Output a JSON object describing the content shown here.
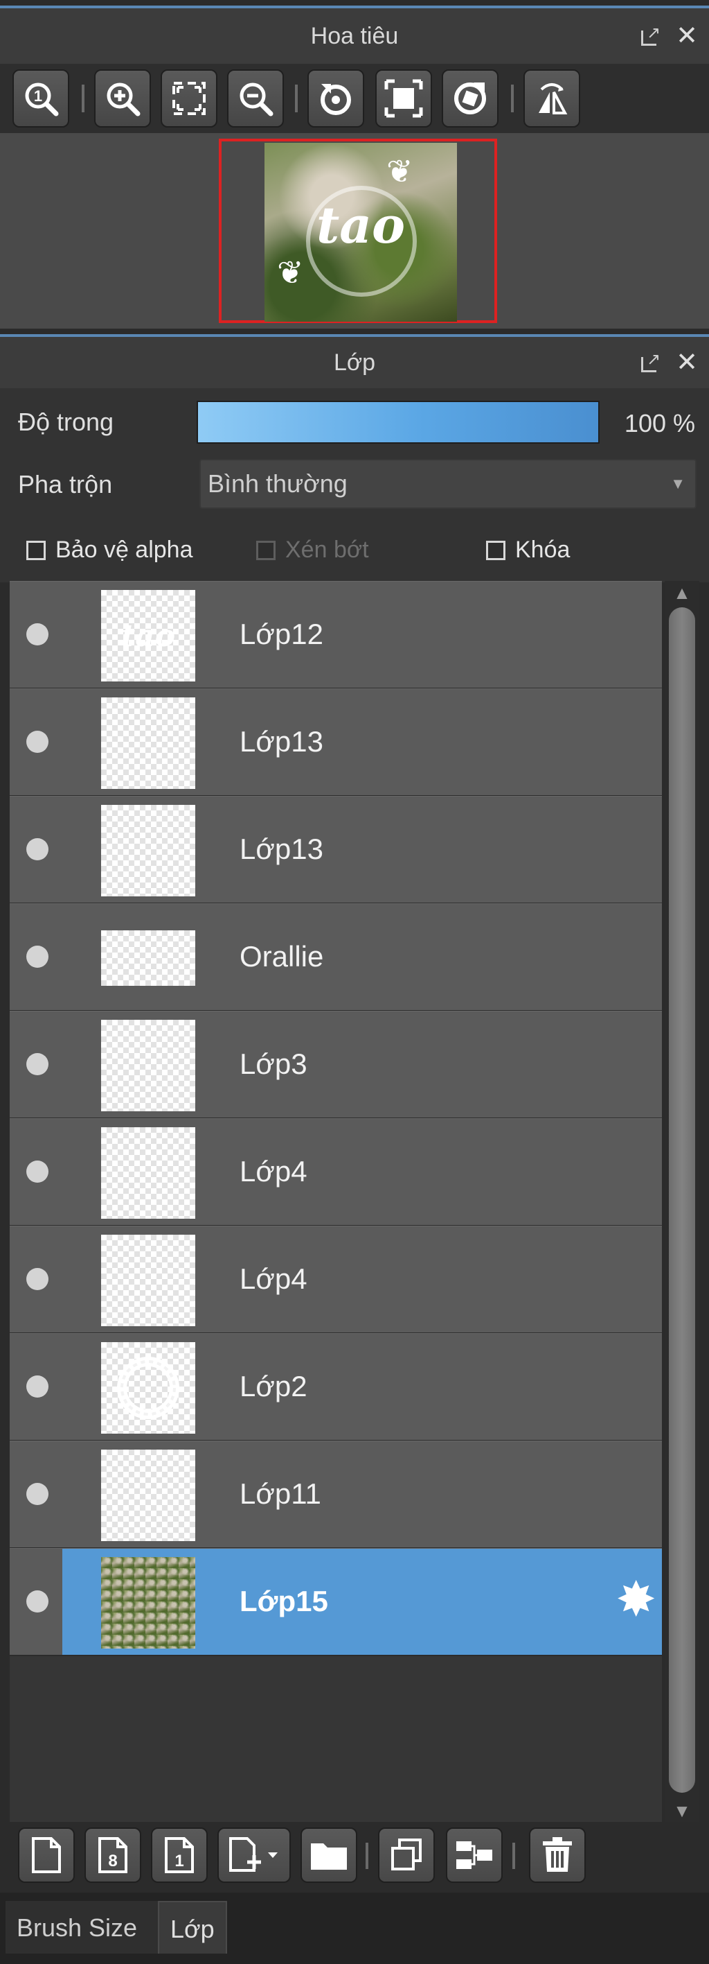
{
  "navigator": {
    "title": "Hoa tiêu",
    "preview_text": "tao",
    "toolbar_icons": [
      "zoom-actual-icon",
      "zoom-in-icon",
      "fit-window-icon",
      "zoom-out-icon",
      "rotate-left-icon",
      "fit-canvas-icon",
      "rotate-right-icon",
      "flip-horizontal-icon"
    ]
  },
  "layer_panel": {
    "title": "Lớp",
    "opacity_label": "Độ trong",
    "opacity_value": "100 %",
    "opacity": 1.0,
    "blend_label": "Pha trộn",
    "blend_value": "Bình thường",
    "protect_alpha_label": "Bảo vệ alpha",
    "clipping_label": "Xén bớt",
    "lock_label": "Khóa",
    "layers": [
      {
        "name": "Lớp12",
        "thumb": "text"
      },
      {
        "name": "Lớp13",
        "thumb": "blank"
      },
      {
        "name": "Lớp13",
        "thumb": "blank"
      },
      {
        "name": "Orallie",
        "thumb": "short"
      },
      {
        "name": "Lớp3",
        "thumb": "blank"
      },
      {
        "name": "Lớp4",
        "thumb": "blank"
      },
      {
        "name": "Lớp4",
        "thumb": "blank"
      },
      {
        "name": "Lớp2",
        "thumb": "ring"
      },
      {
        "name": "Lớp11",
        "thumb": "blank"
      },
      {
        "name": "Lớp15",
        "thumb": "photo",
        "selected": true
      }
    ],
    "bottom_icons": [
      "new-layer-icon",
      "new-8bit-layer-icon",
      "new-1bit-layer-icon",
      "add-layer-dropdown-icon",
      "new-folder-icon",
      "duplicate-layer-icon",
      "merge-down-icon",
      "delete-layer-icon"
    ]
  },
  "tabs": {
    "brush_size": "Brush Size",
    "layer": "Lớp"
  },
  "colors": {
    "accent": "#5599d5",
    "close_red": "#dd2222"
  }
}
